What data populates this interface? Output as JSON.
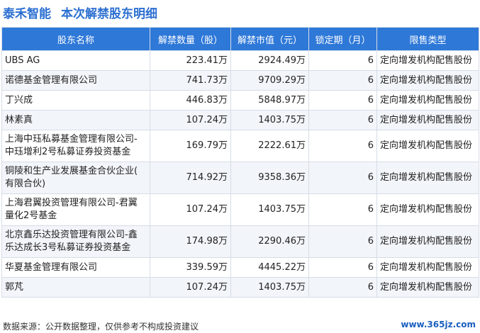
{
  "header": {
    "company": "泰禾智能",
    "subtitle": "本次解禁股东明细"
  },
  "table": {
    "columns": [
      "股东名称",
      "解禁数量（股）",
      "解禁市值（元）",
      "锁定期（月）",
      "限售类型"
    ],
    "rows": [
      {
        "name": [
          "UBS AG"
        ],
        "qty": "223.41万",
        "value": "2924.49万",
        "lock": "6",
        "type": "定向增发机构配售股份"
      },
      {
        "name": [
          "诺德基金管理有限公司"
        ],
        "qty": "741.73万",
        "value": "9709.29万",
        "lock": "6",
        "type": "定向增发机构配售股份"
      },
      {
        "name": [
          "丁兴成"
        ],
        "qty": "446.83万",
        "value": "5848.97万",
        "lock": "6",
        "type": "定向增发机构配售股份"
      },
      {
        "name": [
          "林素真"
        ],
        "qty": "107.24万",
        "value": "1403.75万",
        "lock": "6",
        "type": "定向增发机构配售股份"
      },
      {
        "name": [
          "上海中珏私募基金管理有限公司-",
          "中珏增利2号私募证券投资基金"
        ],
        "qty": "169.79万",
        "value": "2222.61万",
        "lock": "6",
        "type": "定向增发机构配售股份"
      },
      {
        "name": [
          "铜陵和生产业发展基金合伙企业(",
          "有限合伙)"
        ],
        "qty": "714.92万",
        "value": "9358.36万",
        "lock": "6",
        "type": "定向增发机构配售股份"
      },
      {
        "name": [
          "上海君翼投资管理有限公司-君翼",
          "量化2号基金"
        ],
        "qty": "107.24万",
        "value": "1403.75万",
        "lock": "6",
        "type": "定向增发机构配售股份"
      },
      {
        "name": [
          "北京鑫乐达投资管理有限公司-鑫",
          "乐达成长3号私募证券投资基金"
        ],
        "qty": "174.98万",
        "value": "2290.46万",
        "lock": "6",
        "type": "定向增发机构配售股份"
      },
      {
        "name": [
          "华夏基金管理有限公司"
        ],
        "qty": "339.59万",
        "value": "4445.22万",
        "lock": "6",
        "type": "定向增发机构配售股份"
      },
      {
        "name": [
          "郭芃"
        ],
        "qty": "107.24万",
        "value": "1403.75万",
        "lock": "6",
        "type": "定向增发机构配售股份"
      }
    ]
  },
  "footer": {
    "source": "数据来源：公开数据整理，仅供参考不构成投资建议",
    "site": "www.365jz.com"
  }
}
